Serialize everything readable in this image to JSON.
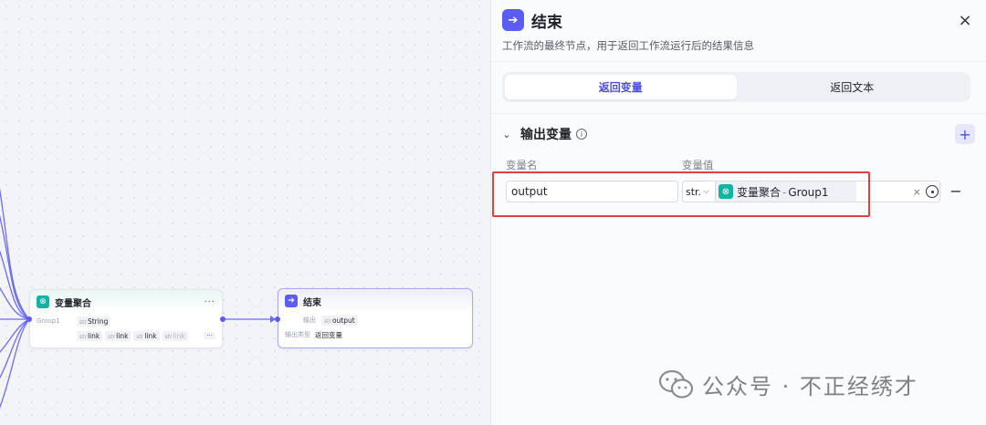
{
  "canvas": {
    "aggregate_node": {
      "title": "变量聚合",
      "more": "···",
      "group_label": "Group1",
      "output_type": "str",
      "output_value": "String",
      "links": [
        {
          "type": "str",
          "name": "link"
        },
        {
          "type": "str",
          "name": "link"
        },
        {
          "type": "str",
          "name": "link"
        },
        {
          "type": "str",
          "name": "link"
        }
      ],
      "links_more": "···"
    },
    "end_node": {
      "title": "结束",
      "output_label": "输出",
      "output_type": "str",
      "output_value": "output",
      "mode_label": "输出类型",
      "mode_value": "返回变量"
    }
  },
  "panel": {
    "title": "结束",
    "close_icon": "×",
    "description": "工作流的最终节点，用于返回工作流运行后的结果信息",
    "tabs": [
      {
        "label": "返回变量",
        "active": true
      },
      {
        "label": "返回文本",
        "active": false
      }
    ],
    "section": {
      "title": "输出变量",
      "info_icon": "i",
      "add_icon": "+",
      "col_name": "变量名",
      "col_value": "变量值"
    },
    "row": {
      "name_value": "output",
      "type_value": "str.",
      "ref_node": "变量聚合",
      "ref_sep": "-",
      "ref_field": "Group1",
      "clear_icon": "×",
      "remove_icon": "−"
    }
  },
  "watermark": {
    "text": "公众号 · 不正经绣才"
  },
  "colors": {
    "accent": "#5b5cf0",
    "teal": "#12b3a3",
    "highlight": "#e0413f"
  }
}
